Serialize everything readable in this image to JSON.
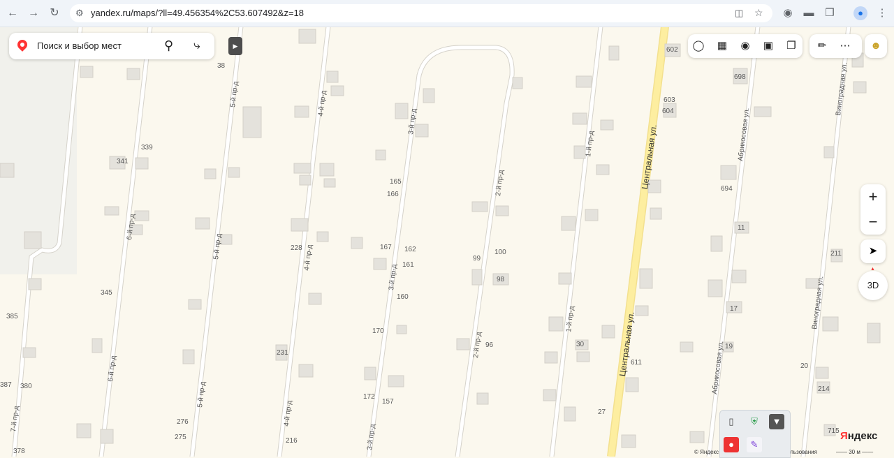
{
  "browser": {
    "back_icon": "arrow-left-icon",
    "forward_icon": "arrow-right-icon",
    "reload_icon": "reload-icon",
    "url": "yandex.ru/maps/?ll=49.456354%2C53.607492&z=18"
  },
  "search": {
    "placeholder": "Поиск и выбор мест"
  },
  "streets": [
    {
      "label": "7-й пр-д"
    },
    {
      "label": "6-й пр-д"
    },
    {
      "label": "5-й пр-д"
    },
    {
      "label": "4-й пр-д"
    },
    {
      "label": "3-й пр-д"
    },
    {
      "label": "2-й пр-д"
    },
    {
      "label": "1-й пр-д"
    },
    {
      "label": "Центральная ул."
    },
    {
      "label": "Абрикосовая ул."
    },
    {
      "label": "Виноградная ул."
    }
  ],
  "house_numbers": [
    "38",
    "339",
    "341",
    "345",
    "385",
    "387",
    "380",
    "276",
    "275",
    "378",
    "231",
    "216",
    "228",
    "165",
    "166",
    "167",
    "162",
    "161",
    "160",
    "170",
    "172",
    "157",
    "99",
    "100",
    "98",
    "96",
    "30",
    "27",
    "611",
    "602",
    "603",
    "604",
    "698",
    "694",
    "11",
    "17",
    "19",
    "20",
    "211",
    "214",
    "715"
  ],
  "zoom": {
    "in": "+",
    "out": "−"
  },
  "view_mode": "3D",
  "branding": {
    "logo_ru": "Я",
    "logo_rest": "ндекс",
    "copyright": "© Яндекс",
    "terms": "льзования",
    "scale": "30 м"
  },
  "colors": {
    "map_bg": "#fbf8ee",
    "main_road": "#fdeea0",
    "building": "#e4e2dc",
    "accent_red": "#ff3333"
  }
}
